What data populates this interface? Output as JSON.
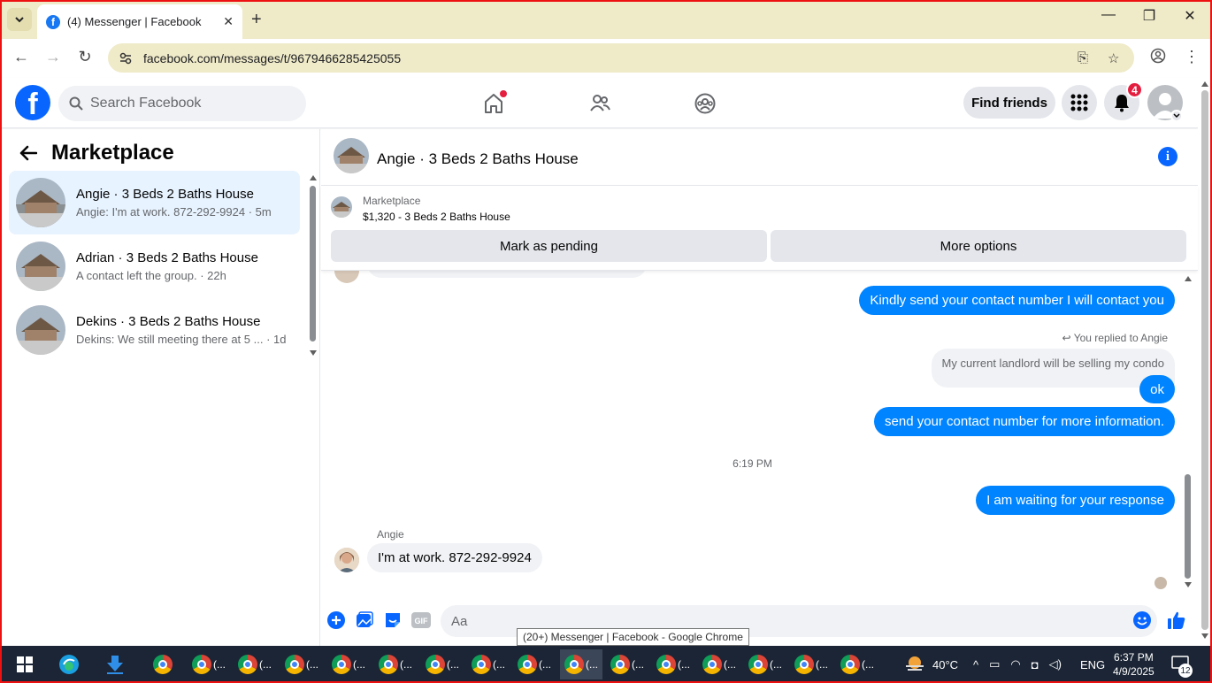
{
  "browser": {
    "tab_title": "(4) Messenger | Facebook",
    "url": "facebook.com/messages/t/9679466285425055",
    "tooltip": "(20+) Messenger | Facebook - Google Chrome"
  },
  "header": {
    "search_placeholder": "Search Facebook",
    "find_friends_label": "Find friends",
    "notification_count": "4"
  },
  "sidebar": {
    "title": "Marketplace",
    "conversations": [
      {
        "name": "Angie · 3 Beds 2 Baths House",
        "preview": "Angie: I'm at work. 872-292-9924 · 5m",
        "active": true
      },
      {
        "name": "Adrian · 3 Beds 2 Baths House",
        "preview": "A contact left the group. · 22h",
        "active": false
      },
      {
        "name": "Dekins · 3 Beds 2 Baths House",
        "preview": "Dekins: We still meeting there at 5 ... · 1d",
        "active": false
      }
    ]
  },
  "chat": {
    "title": "Angie · 3 Beds 2 Baths House",
    "listing": {
      "category": "Marketplace",
      "price_title": "$1,320 - 3 Beds 2 Baths House",
      "mark_pending_label": "Mark as pending",
      "more_options_label": "More options"
    },
    "messages": [
      {
        "type": "out",
        "text": "Kindly send your contact number I will contact you"
      },
      {
        "type": "replied",
        "text": "You replied to Angie"
      },
      {
        "type": "quote",
        "text": "My current landlord will be selling my condo"
      },
      {
        "type": "out",
        "text": "ok"
      },
      {
        "type": "out",
        "text": "send your contact number for more information."
      },
      {
        "type": "time",
        "text": "6:19 PM"
      },
      {
        "type": "out",
        "text": "I am waiting for your response"
      },
      {
        "type": "sender",
        "text": "Angie"
      },
      {
        "type": "in",
        "text": "I'm at work. 872-292-9924"
      }
    ],
    "composer_placeholder": "Aa"
  },
  "taskbar": {
    "weather_temp": "40°C",
    "language": "ENG",
    "time": "6:37 PM",
    "date": "4/9/2025",
    "notif_count": "12",
    "app_label": "(..."
  }
}
